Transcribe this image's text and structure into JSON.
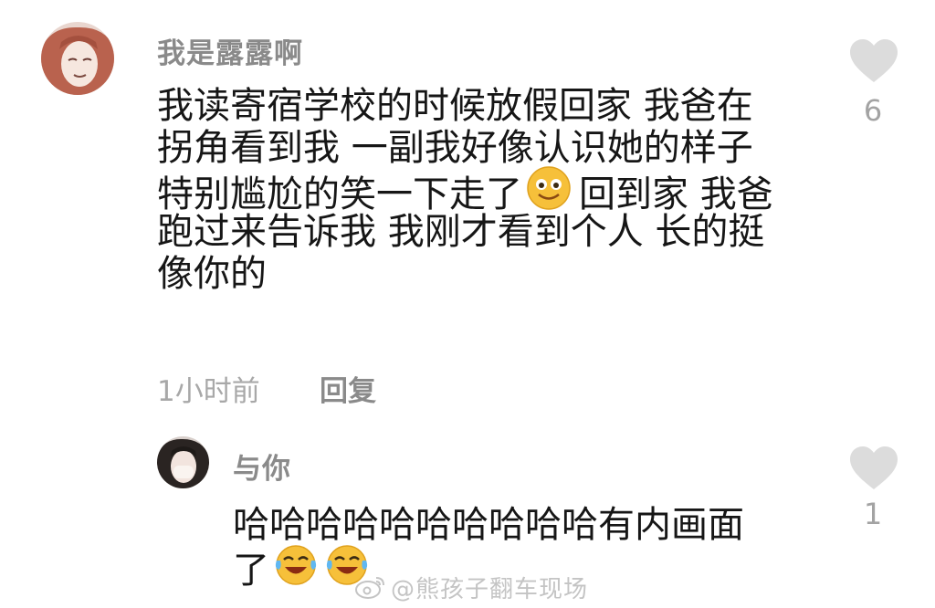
{
  "comment": {
    "username": "我是露露啊",
    "lines": [
      "我读寄宿学校的时候放假回家 我爸在",
      "拐角看到我 一副我好像认识她的样子",
      "特别尴尬的笑一下走了",
      "回到家 我爸",
      "跑过来告诉我 我刚才看到个人 长的挺",
      "像你的"
    ],
    "emoji_icon": "smiling-face-icon",
    "time": "1小时前",
    "reply_label": "回复",
    "likes": "6"
  },
  "reply": {
    "username": "与你",
    "lines": [
      "哈哈哈哈哈哈哈哈哈哈有内画面",
      "了"
    ],
    "emoji_icon": "laughing-tears-icon",
    "likes": "1"
  },
  "watermark": {
    "icon": "weibo-icon",
    "text": "@熊孩子翻车现场"
  },
  "colors": {
    "username": "#8a8a8a",
    "body": "#161616",
    "heart": "#dcdcdc",
    "emoji_yellow": "#f6c03a"
  }
}
